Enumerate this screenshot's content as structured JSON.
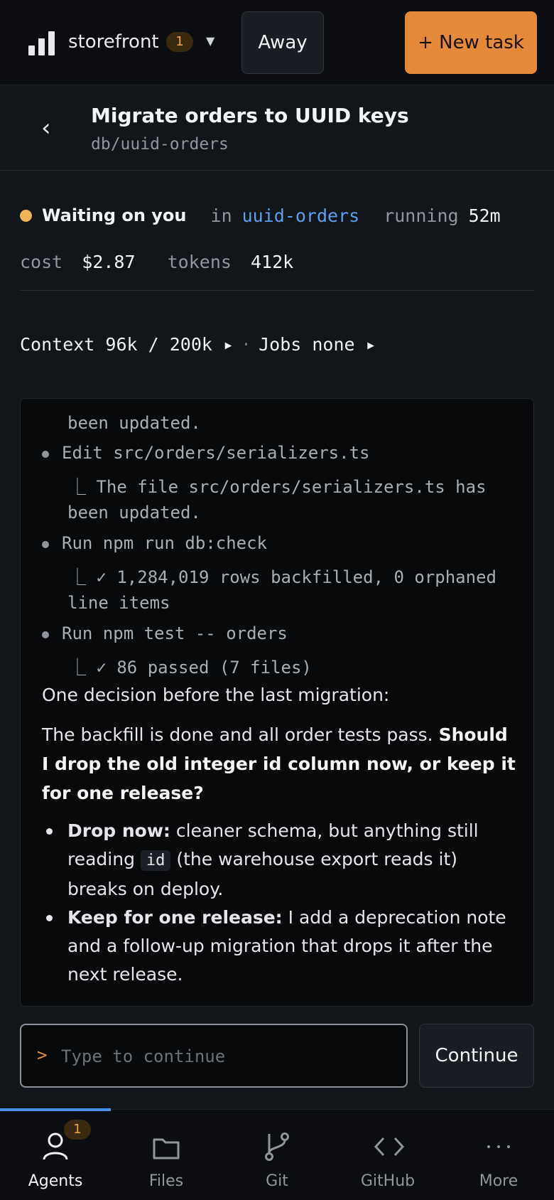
{
  "topbar": {
    "app_name": "storefront",
    "badge_count": "1",
    "away_label": "Away",
    "new_task_label": "+ New task"
  },
  "header": {
    "title": "Migrate orders to UUID keys",
    "subtitle": "db/uuid-orders"
  },
  "status": {
    "state": "Waiting on you",
    "in_label": "in",
    "workspace": "uuid-orders",
    "running_label": "running",
    "running_value": "52m",
    "cost_label": "cost",
    "cost_value": "$2.87",
    "tokens_label": "tokens",
    "tokens_value": "412k",
    "context_text": "Context 96k / 200k ▸",
    "jobs_text": "Jobs none ▸",
    "accent_color": "#f0b458"
  },
  "transcript": {
    "lines": [
      "been updated.",
      "Edit src/orders/serializers.ts",
      "⎿ The file src/orders/serializers.ts has",
      "been updated.",
      "Run npm run db:check",
      "⎿ ✓ 1,284,019 rows backfilled, 0 orphaned",
      "line items",
      "Run npm test -- orders",
      "⎿ ✓ 86 passed (7 files)"
    ],
    "intro": "One decision before the last migration:",
    "question_lead": "The backfill is done and all order tests pass. ",
    "question_bold": "Should I drop the old integer id column now, or keep it for one release?",
    "option1_bold": "Drop now:",
    "option1_text_a": " cleaner schema, but anything still reading ",
    "option1_code": "id",
    "option1_text_b": " (the warehouse export reads it) breaks on deploy.",
    "option2_bold": "Keep for one release:",
    "option2_text": " I add a deprecation note and a follow-up migration that drops it after the next release."
  },
  "composer": {
    "prompt_symbol": ">",
    "placeholder": "Type to continue",
    "continue_label": "Continue"
  },
  "nav": {
    "items": [
      {
        "label": "Agents",
        "icon": "person-icon",
        "badge": "1"
      },
      {
        "label": "Files",
        "icon": "folder-icon"
      },
      {
        "label": "Git",
        "icon": "git-branch-icon"
      },
      {
        "label": "GitHub",
        "icon": "code-icon"
      },
      {
        "label": "More",
        "icon": "more-dots-icon"
      }
    ],
    "active_color": "#4a8fe6"
  },
  "colors": {
    "brand_orange": "#e58a3a",
    "link_blue": "#5aa0ee"
  }
}
